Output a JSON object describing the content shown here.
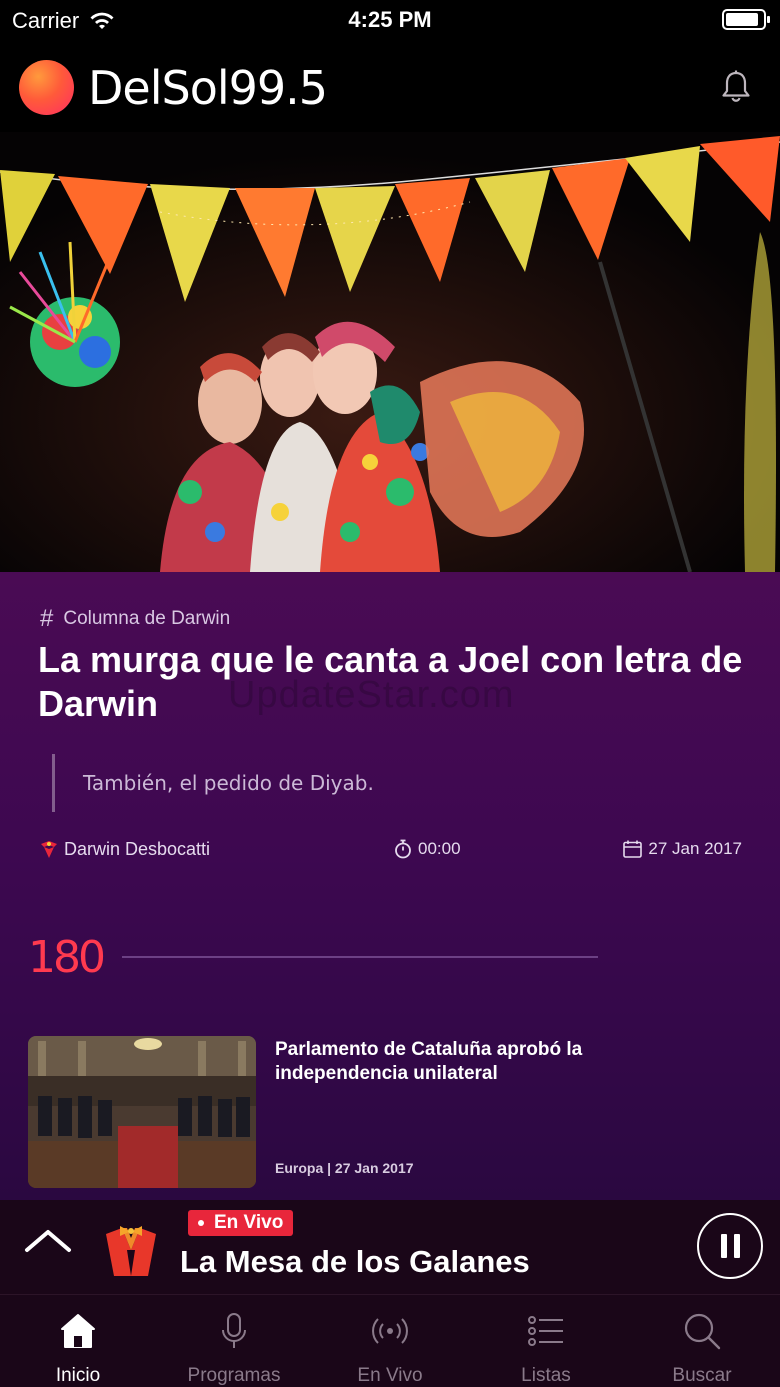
{
  "status_bar": {
    "carrier": "Carrier",
    "time": "4:25 PM",
    "battery_level": 0.9
  },
  "header": {
    "logo_text": "DelSol99.5",
    "notification_icon": "bell-icon"
  },
  "article": {
    "category": "Columna de Darwin",
    "title": "La murga que le canta a Joel con letra de Darwin",
    "watermark": "UpdateStar.com",
    "quote": "También, el pedido de Diyab.",
    "author": "Darwin Desbocatti",
    "duration": "00:00",
    "date": "27 Jan 2017"
  },
  "section": {
    "logo_text": "180"
  },
  "news": [
    {
      "title": "Parlamento de Cataluña aprobó la independencia unilateral",
      "meta": "Europa | 27 Jan 2017"
    }
  ],
  "player": {
    "live_label": "En Vivo",
    "show_title": "La Mesa de los Galanes",
    "state": "playing"
  },
  "tabs": [
    {
      "label": "Inicio",
      "icon": "home-icon",
      "active": true
    },
    {
      "label": "Programas",
      "icon": "microphone-icon",
      "active": false
    },
    {
      "label": "En Vivo",
      "icon": "broadcast-icon",
      "active": false
    },
    {
      "label": "Listas",
      "icon": "list-icon",
      "active": false
    },
    {
      "label": "Buscar",
      "icon": "search-icon",
      "active": false
    }
  ],
  "colors": {
    "accent": "#e8263b",
    "article_bg": "#4a0b54",
    "player_bg": "#1a0618"
  }
}
